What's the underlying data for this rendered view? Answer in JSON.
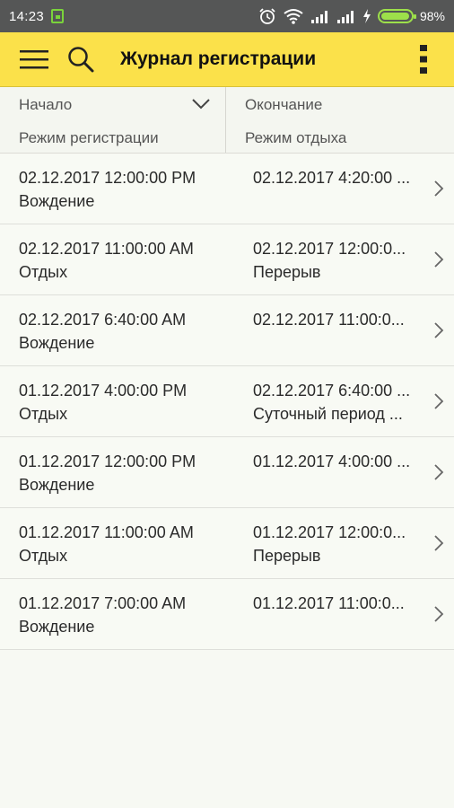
{
  "status_bar": {
    "time": "14:23",
    "battery_pct": "98%",
    "battery_level": 0.98
  },
  "appbar": {
    "title": "Журнал регистрации"
  },
  "header": {
    "start_label": "Начало",
    "end_label": "Окончание",
    "mode_label": "Режим регистрации",
    "rest_label": "Режим отдыха"
  },
  "rows": [
    {
      "start": "02.12.2017 12:00:00 PM",
      "mode": "Вождение",
      "end": "02.12.2017 4:20:00 ...",
      "rest": ""
    },
    {
      "start": "02.12.2017 11:00:00 AM",
      "mode": "Отдых",
      "end": "02.12.2017 12:00:0...",
      "rest": "Перерыв"
    },
    {
      "start": "02.12.2017 6:40:00 AM",
      "mode": "Вождение",
      "end": "02.12.2017 11:00:0...",
      "rest": ""
    },
    {
      "start": "01.12.2017 4:00:00 PM",
      "mode": "Отдых",
      "end": "02.12.2017 6:40:00 ...",
      "rest": "Суточный период ..."
    },
    {
      "start": "01.12.2017 12:00:00 PM",
      "mode": "Вождение",
      "end": "01.12.2017 4:00:00 ...",
      "rest": ""
    },
    {
      "start": "01.12.2017 11:00:00 AM",
      "mode": "Отдых",
      "end": "01.12.2017 12:00:0...",
      "rest": "Перерыв"
    },
    {
      "start": "01.12.2017 7:00:00 AM",
      "mode": "Вождение",
      "end": "01.12.2017 11:00:0...",
      "rest": ""
    }
  ],
  "colors": {
    "appbar": "#fbe14a",
    "statusbar": "#555656",
    "battery": "#9de04a"
  }
}
